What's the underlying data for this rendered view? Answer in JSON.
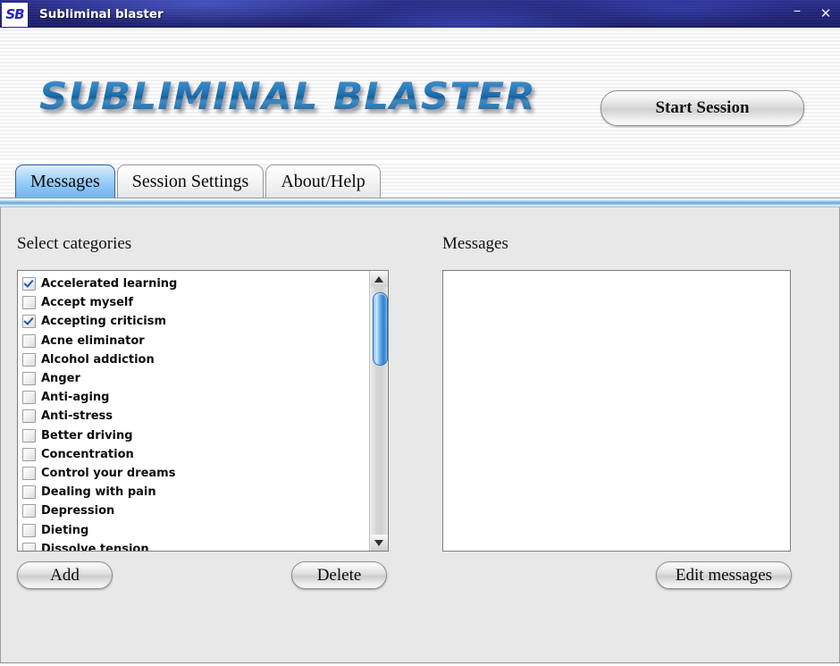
{
  "window": {
    "title": "Subliminal blaster",
    "app_icon_text": "SB",
    "controls": {
      "minimize": "–",
      "close": "✕"
    }
  },
  "banner": {
    "logo_text": "SUBLIMINAL BLASTER",
    "start_session_label": "Start Session",
    "logo_color": "#2a7fc0"
  },
  "tabs": [
    {
      "label": "Messages",
      "active": true
    },
    {
      "label": "Session Settings",
      "active": false
    },
    {
      "label": "About/Help",
      "active": false
    }
  ],
  "main": {
    "categories_label": "Select categories",
    "messages_label": "Messages",
    "categories": [
      {
        "label": "Accelerated learning",
        "checked": true
      },
      {
        "label": "Accept myself",
        "checked": false
      },
      {
        "label": "Accepting criticism",
        "checked": true
      },
      {
        "label": "Acne eliminator",
        "checked": false
      },
      {
        "label": "Alcohol addiction",
        "checked": false
      },
      {
        "label": "Anger",
        "checked": false
      },
      {
        "label": "Anti-aging",
        "checked": false
      },
      {
        "label": "Anti-stress",
        "checked": false
      },
      {
        "label": "Better driving",
        "checked": false
      },
      {
        "label": "Concentration",
        "checked": false
      },
      {
        "label": "Control your dreams",
        "checked": false
      },
      {
        "label": "Dealing with pain",
        "checked": false
      },
      {
        "label": "Depression",
        "checked": false
      },
      {
        "label": "Dieting",
        "checked": false
      },
      {
        "label": "Dissolve tension",
        "checked": false
      }
    ],
    "messages_items": [],
    "buttons": {
      "add": "Add",
      "delete": "Delete",
      "edit_messages": "Edit messages"
    },
    "scrollbar": {
      "up_arrow_icon": "triangle-up-icon",
      "down_arrow_icon": "triangle-down-icon",
      "thumb_color": "#3f93de"
    }
  }
}
